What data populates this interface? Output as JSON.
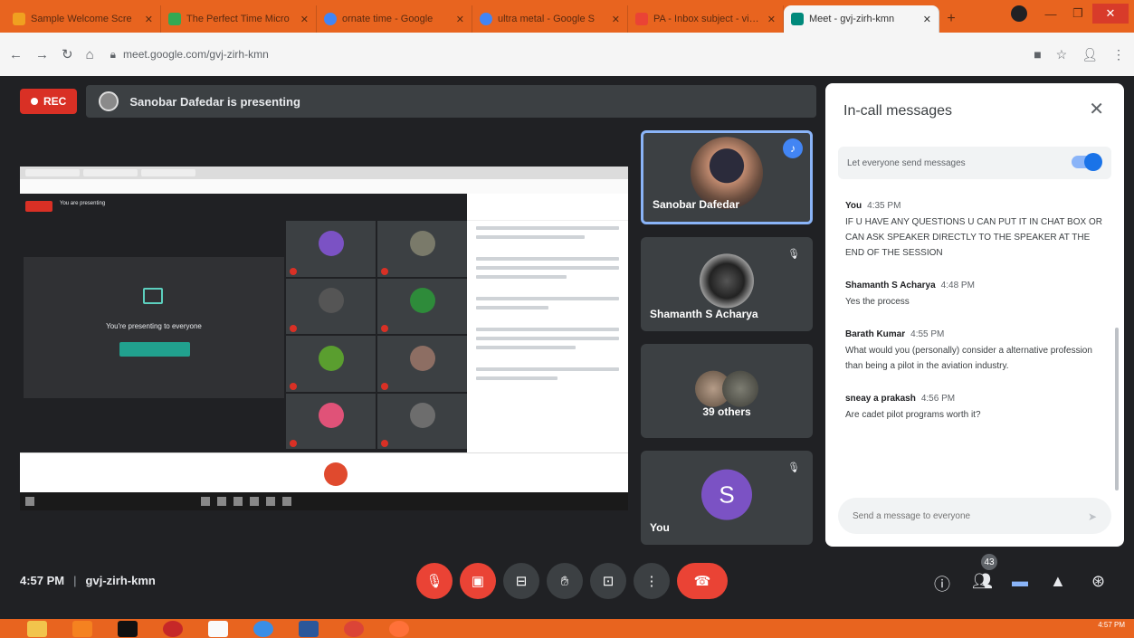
{
  "browser": {
    "tabs": [
      {
        "title": "Sample Welcome Scre",
        "favicon_color": "#f0a020"
      },
      {
        "title": "The Perfect Time Micro",
        "favicon_color": "#34a853"
      },
      {
        "title": "ornate time - Google",
        "favicon_color": "#4285f4"
      },
      {
        "title": "ultra metal - Google S",
        "favicon_color": "#4285f4"
      },
      {
        "title": "PA - Inbox subject - vineeth",
        "favicon_color": "#ea4335"
      },
      {
        "title": "Meet - gvj-zirh-kmn",
        "favicon_color": "#00897b",
        "active": true
      }
    ],
    "address": "meet.google.com/gvj-zirh-kmn"
  },
  "meeting": {
    "rec_label": "REC",
    "presenting_text": "Sanobar Dafedar is presenting",
    "time": "4:57 PM",
    "code": "gvj-zirh-kmn",
    "participant_badge": "43"
  },
  "presented": {
    "presenting_to_everyone": "You're presenting to everyone",
    "tab_title": "Meet - gvj-zirh-kmn",
    "url": "meet.google.com/gvj-zirh-kmn",
    "you_presenting": "You are presenting"
  },
  "tiles": [
    {
      "name": "Sanobar Dafedar",
      "type": "photo1",
      "active": true
    },
    {
      "name": "Shamanth S Acharya",
      "type": "photo2"
    },
    {
      "name": "39 others",
      "type": "group"
    },
    {
      "name": "You",
      "type": "letter",
      "letter": "S"
    }
  ],
  "chat": {
    "title": "In-call messages",
    "close_icon": "close-icon",
    "toggle_label": "Let everyone send messages",
    "toggle_on": true,
    "messages": [
      {
        "sender": "You",
        "time": "4:35 PM",
        "text": "IF U HAVE ANY QUESTIONS U CAN PUT IT IN CHAT BOX OR CAN ASK SPEAKER DIRECTLY TO THE SPEAKER AT THE END OF THE SESSION"
      },
      {
        "sender": "Shamanth S Acharya",
        "time": "4:48 PM",
        "text": "Yes the process"
      },
      {
        "sender": "Barath Kumar",
        "time": "4:55 PM",
        "text": "What would you (personally) consider a alternative profession than being a pilot in the aviation industry."
      },
      {
        "sender": "sneay a prakash",
        "time": "4:56 PM",
        "text": "Are cadet pilot programs worth it?"
      }
    ],
    "input_placeholder": "Send a message to everyone"
  },
  "colors": {
    "meet_bg": "#202124",
    "tile_bg": "#3c4043",
    "red": "#ea4335",
    "blue_accent": "#1a73e8",
    "taskbar": "#e8641f"
  }
}
